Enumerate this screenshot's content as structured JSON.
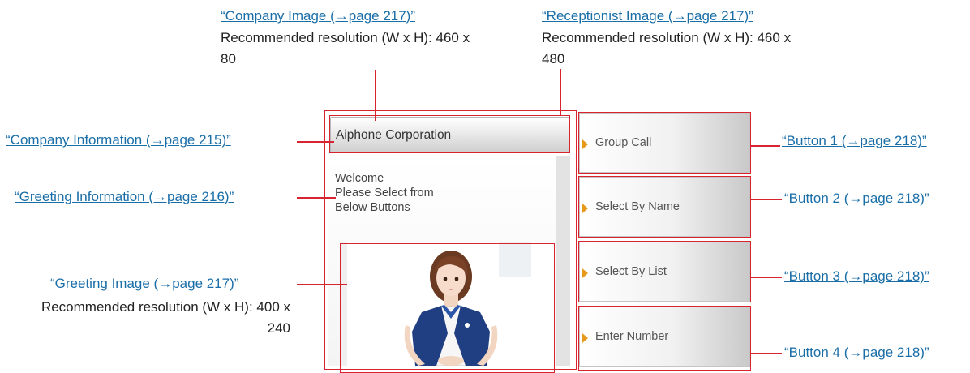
{
  "annotations": {
    "company_image": {
      "link": "“Company Image (→page 217)”",
      "note": "Recommended resolution (W x H): 460 x 80"
    },
    "receptionist_image": {
      "link": "“Receptionist Image (→page 217)”",
      "note": "Recommended resolution (W x H): 460 x 480"
    },
    "company_information": {
      "link": "“Company Information (→page 215)”"
    },
    "greeting_information": {
      "link": "“Greeting Information (→page 216)”"
    },
    "greeting_image": {
      "link": "“Greeting Image (→page 217)”",
      "note": "Recommended resolution (W x H): 400 x 240"
    },
    "buttons": [
      "“Button 1 (→page 218)”",
      "“Button 2 (→page 218)”",
      "“Button 3 (→page 218)”",
      "“Button 4 (→page 218)”"
    ]
  },
  "screen": {
    "company_name": "Aiphone Corporation",
    "greeting_lines": [
      "Welcome",
      "Please Select from",
      "Below Buttons"
    ],
    "buttons": [
      "Group Call",
      "Select By Name",
      "Select By List",
      "Enter Number"
    ]
  },
  "colors": {
    "annotation_red": "#d9242f",
    "link_blue": "#1a6ea8",
    "button_arrow": "#e59a1c"
  }
}
